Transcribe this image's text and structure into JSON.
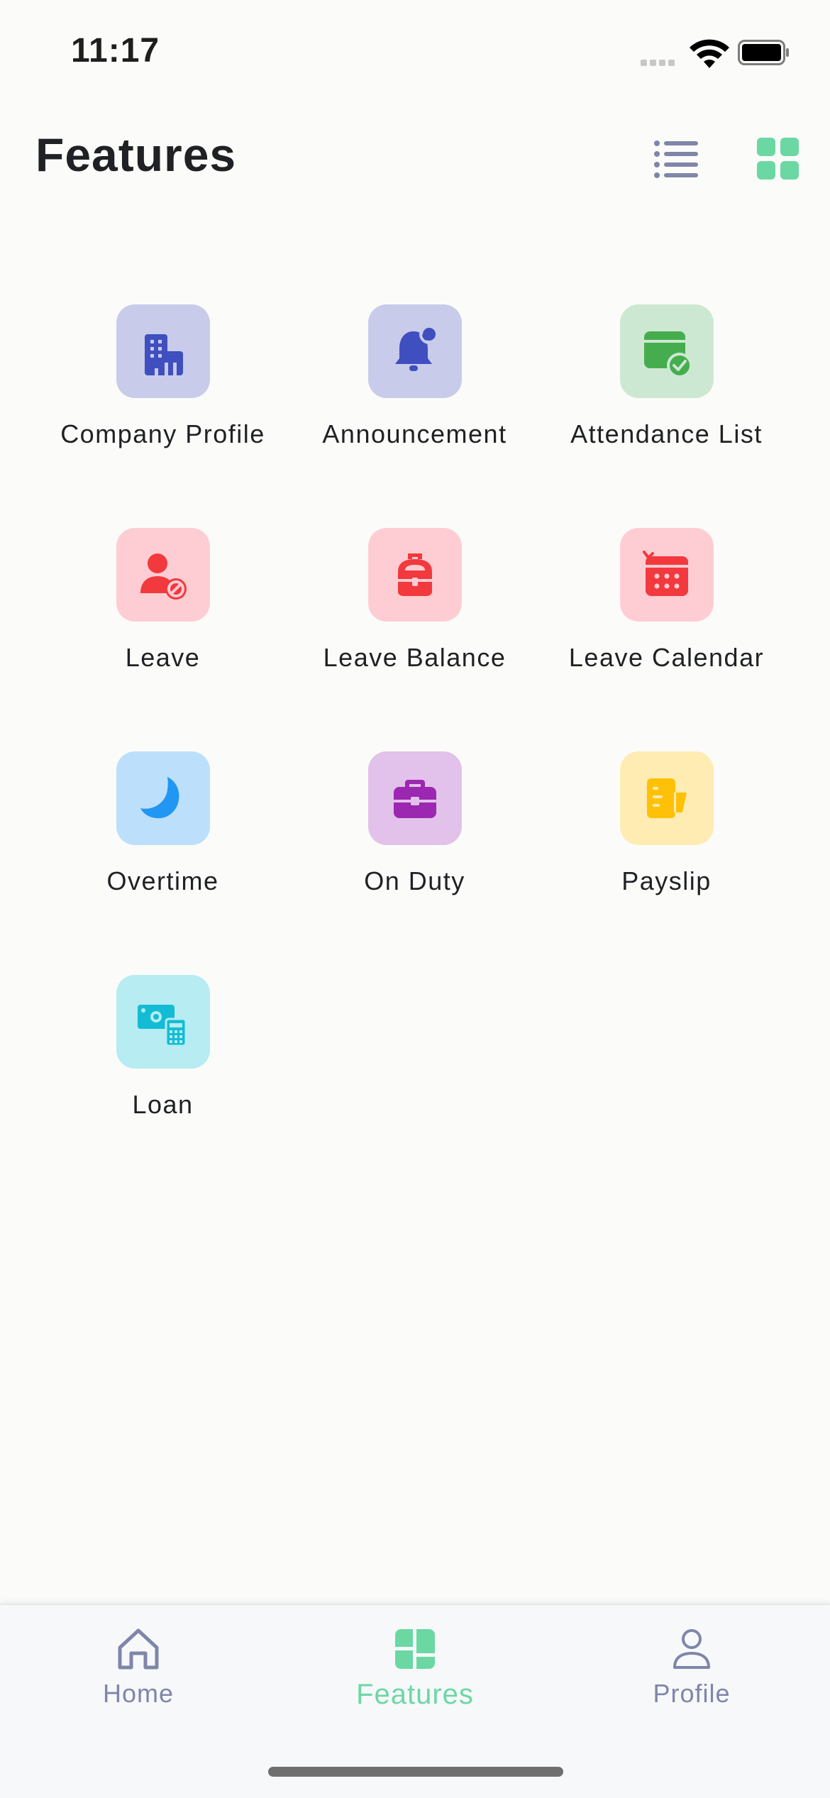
{
  "status_bar": {
    "time": "11:17"
  },
  "header": {
    "title": "Features"
  },
  "colors": {
    "accent": "#6bd8a4",
    "nav_inactive": "#7f86a8",
    "background": "#fbfcf9"
  },
  "features": [
    {
      "label": "Company Profile",
      "icon": "building-icon",
      "tile_color": "#c8cbea",
      "icon_color": "#3f4fbf"
    },
    {
      "label": "Announcement",
      "icon": "bell-icon",
      "tile_color": "#c8cbea",
      "icon_color": "#3f4fbf"
    },
    {
      "label": "Attendance List",
      "icon": "calendar-check-icon",
      "tile_color": "#cde8d2",
      "icon_color": "#46ad4f"
    },
    {
      "label": "Leave",
      "icon": "user-block-icon",
      "tile_color": "#fecdd3",
      "icon_color": "#f2393d"
    },
    {
      "label": "Leave Balance",
      "icon": "backpack-icon",
      "tile_color": "#fecdd3",
      "icon_color": "#f2393d"
    },
    {
      "label": "Leave Calendar",
      "icon": "calendar-icon",
      "tile_color": "#fecdd3",
      "icon_color": "#f2393d"
    },
    {
      "label": "Overtime",
      "icon": "moon-icon",
      "tile_color": "#bcdffc",
      "icon_color": "#2196f3"
    },
    {
      "label": "On Duty",
      "icon": "briefcase-icon",
      "tile_color": "#e2c1ea",
      "icon_color": "#9c27b0"
    },
    {
      "label": "Payslip",
      "icon": "receipt-icon",
      "tile_color": "#ffecb3",
      "icon_color": "#ffc107"
    },
    {
      "label": "Loan",
      "icon": "money-calculator-icon",
      "tile_color": "#b6ecf2",
      "icon_color": "#13bcd4"
    }
  ],
  "bottom_nav": {
    "items": [
      {
        "label": "Home",
        "icon": "home-icon",
        "active": false
      },
      {
        "label": "Features",
        "icon": "features-icon",
        "active": true
      },
      {
        "label": "Profile",
        "icon": "profile-icon",
        "active": false
      }
    ]
  }
}
